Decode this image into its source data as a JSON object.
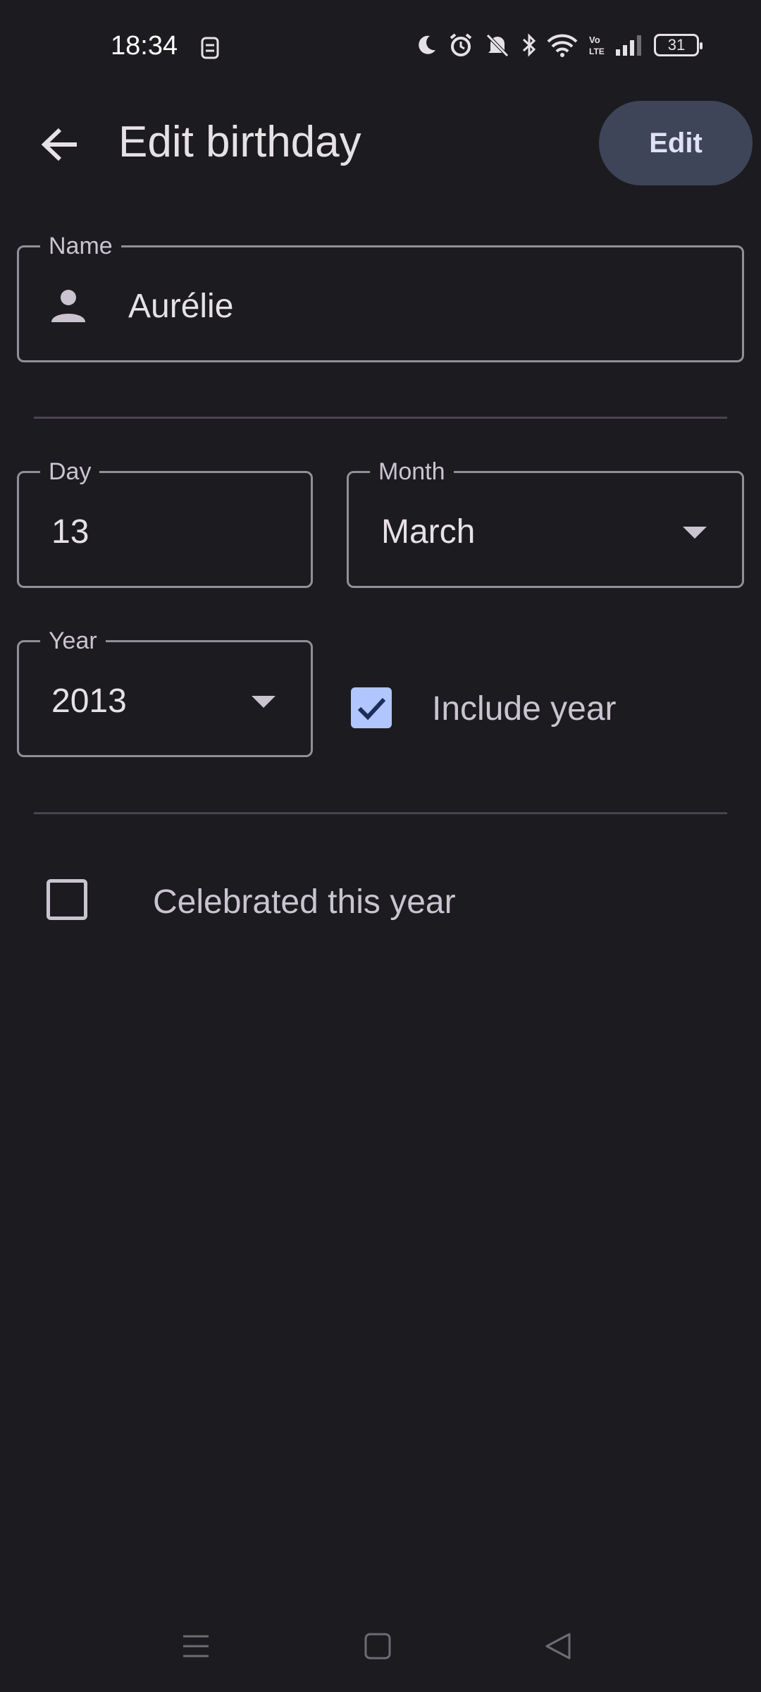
{
  "status_bar": {
    "time": "18:34",
    "battery": "31",
    "icons": [
      "sim-icon",
      "moon-icon",
      "alarm-icon",
      "mute-icon",
      "bluetooth-icon",
      "wifi-icon",
      "volte-icon",
      "signal-icon",
      "battery-icon"
    ]
  },
  "app_bar": {
    "title": "Edit birthday",
    "edit_label": "Edit"
  },
  "form": {
    "name": {
      "label": "Name",
      "value": "Aurélie"
    },
    "day": {
      "label": "Day",
      "value": "13"
    },
    "month": {
      "label": "Month",
      "value": "March"
    },
    "year": {
      "label": "Year",
      "value": "2013"
    },
    "include_year": {
      "label": "Include year",
      "checked": true
    },
    "celebrated": {
      "label": "Celebrated this year",
      "checked": false
    }
  },
  "colors": {
    "background": "#1c1b1f",
    "accent": "#b1c5ff",
    "button_bg": "#3f4558",
    "outline": "#938f99"
  }
}
